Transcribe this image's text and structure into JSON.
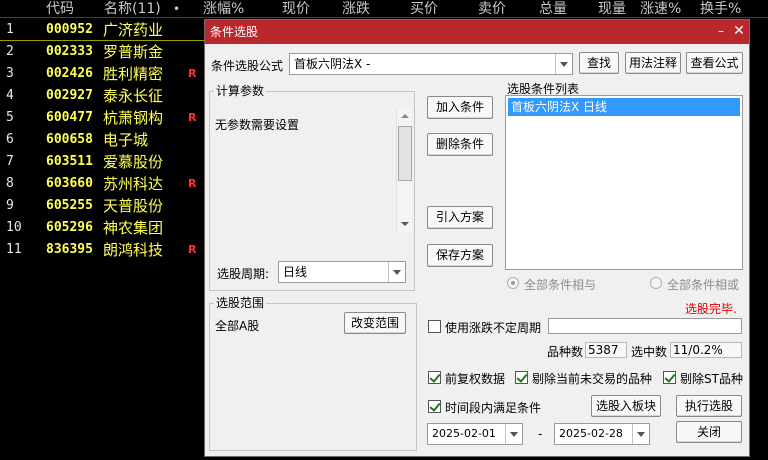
{
  "table": {
    "columns": [
      "代码",
      "名称(11)",
      "•",
      "涨幅%",
      "现价",
      "涨跌",
      "买价",
      "卖价",
      "总量",
      "现量",
      "涨速%",
      "换手%"
    ],
    "rows": [
      {
        "idx": "1",
        "code": "000952",
        "name": "广济药业",
        "flag": ""
      },
      {
        "idx": "2",
        "code": "002333",
        "name": "罗普斯金",
        "flag": ""
      },
      {
        "idx": "3",
        "code": "002426",
        "name": "胜利精密",
        "flag": "R"
      },
      {
        "idx": "4",
        "code": "002927",
        "name": "泰永长征",
        "flag": ""
      },
      {
        "idx": "5",
        "code": "600477",
        "name": "杭萧钢构",
        "flag": "R"
      },
      {
        "idx": "6",
        "code": "600658",
        "name": "电子城",
        "flag": ""
      },
      {
        "idx": "7",
        "code": "603511",
        "name": "爱慕股份",
        "flag": ""
      },
      {
        "idx": "8",
        "code": "603660",
        "name": "苏州科达",
        "flag": "R"
      },
      {
        "idx": "9",
        "code": "605255",
        "name": "天普股份",
        "flag": ""
      },
      {
        "idx": "10",
        "code": "605296",
        "name": "神农集团",
        "flag": ""
      },
      {
        "idx": "11",
        "code": "836395",
        "name": "朗鸿科技",
        "flag": "R"
      }
    ]
  },
  "dialog": {
    "title": "条件选股",
    "formula_label": "条件选股公式",
    "formula_value": "首板六阴法X  -",
    "btn_find": "查找",
    "btn_usage": "用法注释",
    "btn_view_formula": "查看公式",
    "params_title": "计算参数",
    "params_text": "无参数需要设置",
    "period_label": "选股周期:",
    "period_value": "日线",
    "btn_add_condition": "加入条件",
    "btn_delete_condition": "删除条件",
    "btn_import_plan": "引入方案",
    "btn_save_plan": "保存方案",
    "condition_list_title": "选股条件列表",
    "condition_list": [
      "首板六阴法X  日线"
    ],
    "radio_all_and": "全部条件相与",
    "radio_all_or": "全部条件相或",
    "status": "选股完毕.",
    "range_title": "选股范围",
    "range_value": "全部A股",
    "btn_change_range": "改变范围",
    "use_uncertain_period": "使用涨跌不定周期",
    "count_label": "品种数",
    "count_value": "5387",
    "selected_label": "选中数",
    "selected_value": "11/0.2%",
    "chk_prerestore": "前复权数据",
    "chk_exclude_no_trade": "剔除当前未交易的品种",
    "chk_exclude_st": "剔除ST品种",
    "chk_time_range": "时间段内满足条件",
    "btn_to_block": "选股入板块",
    "btn_execute": "执行选股",
    "date_from": "2025-02-01",
    "date_sep": "-",
    "date_to": "2025-02-28",
    "btn_close": "关闭"
  },
  "colors": {
    "titlebar": "#b9282d",
    "stock_code": "#ffff54",
    "flag_red": "#ff3030",
    "status_red": "#e00000",
    "list_selection": "#3399ff"
  }
}
